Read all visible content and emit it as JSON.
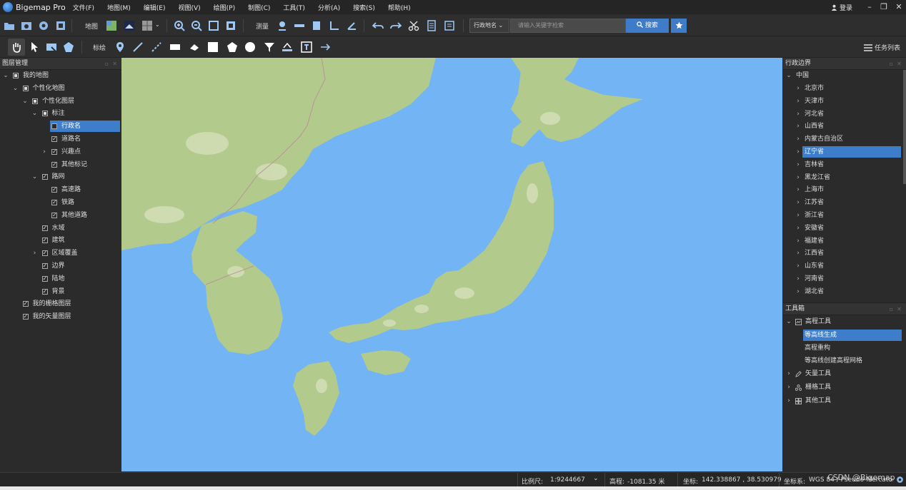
{
  "app": {
    "title": "Bigemap Pro",
    "login": "登录"
  },
  "menu": [
    "文件(F)",
    "地图(M)",
    "编辑(E)",
    "视图(V)",
    "绘图(P)",
    "制图(C)",
    "工具(T)",
    "分析(A)",
    "搜索(S)",
    "帮助(H)"
  ],
  "toolbar1": {
    "map_label": "地图",
    "measure_label": "测量",
    "search_type": "行政地名",
    "search_placeholder": "请输入关键字检索",
    "search_button": "搜索"
  },
  "toolbar2": {
    "annotate_label": "标绘",
    "tasks_label": "任务列表"
  },
  "layers_panel": {
    "title": "图层管理",
    "items": [
      {
        "label": "我的地图"
      },
      {
        "label": "个性化地图"
      },
      {
        "label": "个性化图层"
      },
      {
        "label": "标注"
      },
      {
        "label": "行政名"
      },
      {
        "label": "道路名"
      },
      {
        "label": "兴趣点"
      },
      {
        "label": "其他标记"
      },
      {
        "label": "路网"
      },
      {
        "label": "高速路"
      },
      {
        "label": "铁路"
      },
      {
        "label": "其他道路"
      },
      {
        "label": "水域"
      },
      {
        "label": "建筑"
      },
      {
        "label": "区域覆盖"
      },
      {
        "label": "边界"
      },
      {
        "label": "陆地"
      },
      {
        "label": "背景"
      },
      {
        "label": "我的栅格图层"
      },
      {
        "label": "我的矢量图层"
      }
    ]
  },
  "admin_panel": {
    "title": "行政边界",
    "root": "中国",
    "items": [
      "北京市",
      "天津市",
      "河北省",
      "山西省",
      "内蒙古自治区",
      "辽宁省",
      "吉林省",
      "黑龙江省",
      "上海市",
      "江苏省",
      "浙江省",
      "安徽省",
      "福建省",
      "江西省",
      "山东省",
      "河南省",
      "湖北省"
    ]
  },
  "toolbox_panel": {
    "title": "工具箱",
    "groups": [
      {
        "label": "高程工具"
      },
      {
        "label": "矢量工具"
      },
      {
        "label": "栅格工具"
      },
      {
        "label": "其他工具"
      }
    ],
    "elevation_items": [
      "等高线生成",
      "高程重构",
      "等高线创建高程网格"
    ]
  },
  "status": {
    "scale_label": "比例尺:",
    "scale_value": "1:9244667",
    "elevation_label": "高程:",
    "elevation_value": "-1081.35 米",
    "coord_label": "坐标:",
    "coord_value": "142.338867 , 38.530979",
    "crs_label": "坐标系:",
    "crs_value": "WGS 84 / Pseudo-Mercator",
    "watermark": "CSDN @Bigemap"
  },
  "colors": {
    "sea": "#72b4f4",
    "land": "#b2ca8c",
    "urban": "#d6e0bb",
    "accent": "#3d7dca"
  }
}
